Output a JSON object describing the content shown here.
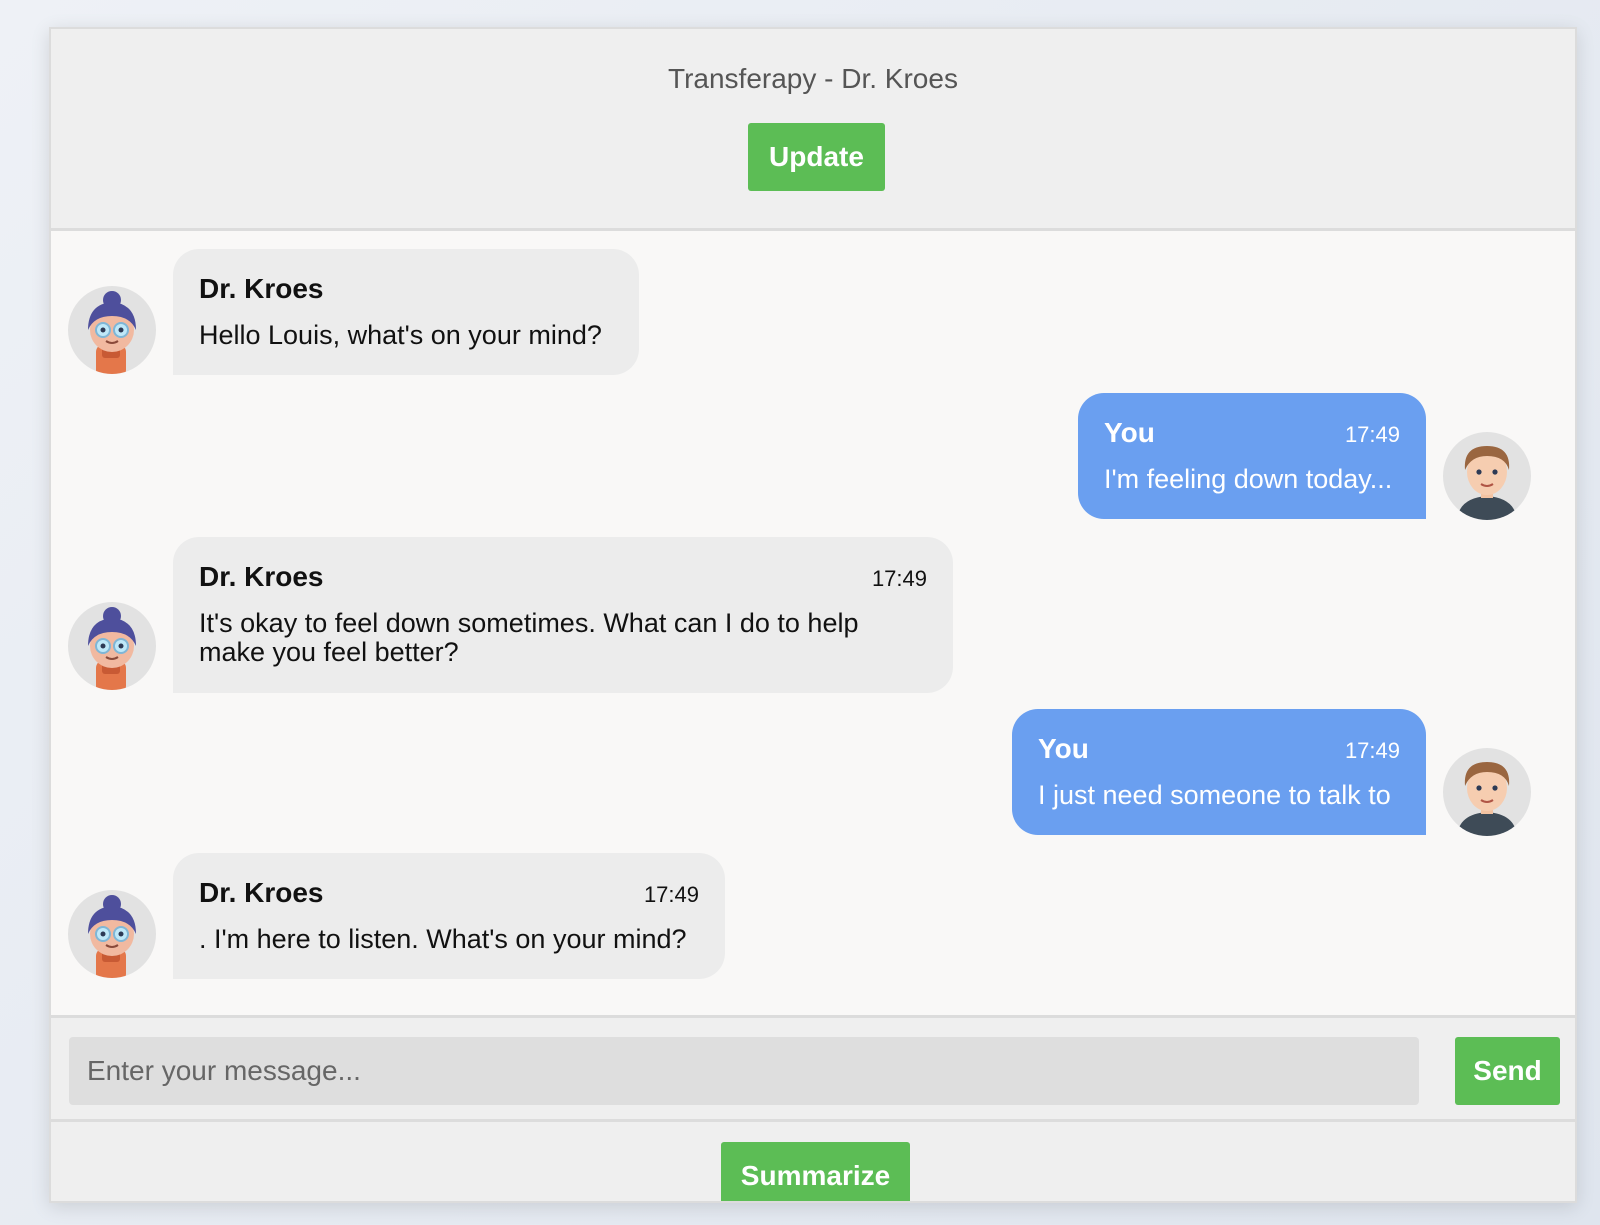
{
  "header": {
    "title": "Transferapy - Dr. Kroes",
    "update_label": "Update"
  },
  "messages": [
    {
      "role": "bot",
      "sender": "Dr. Kroes",
      "time": "",
      "text": "Hello Louis, what's on your mind?"
    },
    {
      "role": "user",
      "sender": "You",
      "time": "17:49",
      "text": "I'm feeling down today..."
    },
    {
      "role": "bot",
      "sender": "Dr. Kroes",
      "time": "17:49",
      "text": "It's okay to feel down sometimes. What can I do to help make you feel better?"
    },
    {
      "role": "user",
      "sender": "You",
      "time": "17:49",
      "text": "I just need someone to talk to"
    },
    {
      "role": "bot",
      "sender": "Dr. Kroes",
      "time": "17:49",
      "text": ". I'm here to listen. What's on your mind?"
    }
  ],
  "composer": {
    "placeholder": "Enter your message...",
    "value": "",
    "send_label": "Send"
  },
  "footer": {
    "summarize_label": "Summarize"
  },
  "colors": {
    "accent_green": "#5cbd55",
    "user_bubble": "#6a9ff0",
    "bot_bubble": "#ececec"
  }
}
